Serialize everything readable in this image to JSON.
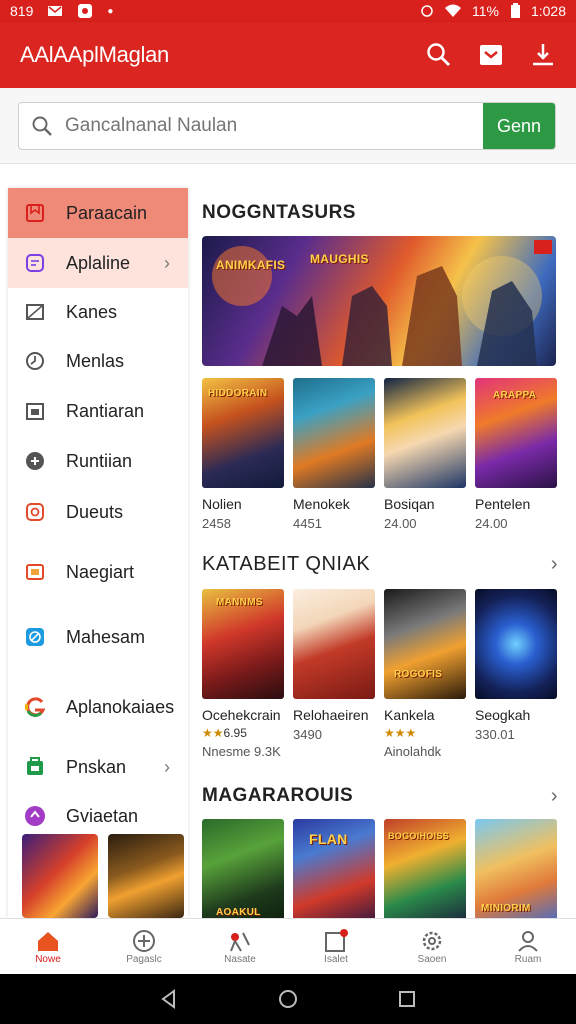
{
  "status": {
    "left_text": "819",
    "battery": "11%",
    "time": "1:028"
  },
  "app": {
    "title": "AAlAAplMaglan"
  },
  "search": {
    "placeholder": "Gancalnanal Naulan",
    "button_label": "Genn"
  },
  "sidebar": {
    "items": [
      {
        "label": "Paraacain",
        "icon": "bookmark-icon",
        "color": "#d8201c"
      },
      {
        "label": "Aplaline",
        "icon": "chat-icon",
        "color": "#7b3fe4"
      },
      {
        "label": "Kanes",
        "icon": "image-icon",
        "color": "#555555"
      },
      {
        "label": "Menlas",
        "icon": "clock-icon",
        "color": "#555555"
      },
      {
        "label": "Rantiaran",
        "icon": "calendar-icon",
        "color": "#555555"
      },
      {
        "label": "Runtiian",
        "icon": "gamepad-icon",
        "color": "#555555"
      },
      {
        "label": "Dueuts",
        "icon": "alarm-icon",
        "color": "#e24a2b"
      },
      {
        "label": "Naegiart",
        "icon": "wallet-icon",
        "color": "#e24a2b"
      },
      {
        "label": "Mahesam",
        "icon": "compass-icon",
        "color": "#1e9be0"
      },
      {
        "label": "Aplanokaiaes",
        "icon": "google-icon",
        "color": "#e24a2b"
      },
      {
        "label": "Pnskan",
        "icon": "bag-icon",
        "color": "#1f9a4a"
      },
      {
        "label": "Gviaetan",
        "icon": "puzzle-icon",
        "color": "#a23cc6"
      }
    ]
  },
  "sections": [
    {
      "title": "NOGGNTASURS",
      "banner_texts": [
        "ANIMKAFIS",
        "MAUGHIS"
      ],
      "cards": [
        {
          "name": "Nolien",
          "sub": "2458",
          "art_text": "HIDDORAIN"
        },
        {
          "name": "Menokek",
          "sub": "4451",
          "art_text": ""
        },
        {
          "name": "Bosiqan",
          "sub": "24.00",
          "art_text": ""
        },
        {
          "name": "Pentelen",
          "sub": "24.00",
          "art_text": "ARAPPA"
        }
      ]
    },
    {
      "title": "KATABEIT QNIAK",
      "cards": [
        {
          "name": "Ocehekcrain",
          "stars": "★★",
          "rating": "6.95",
          "sub": "Nnesme 9.3K",
          "art_text": "MANNMS"
        },
        {
          "name": "Relohaeiren",
          "sub": "3490",
          "art_text": ""
        },
        {
          "name": "Kankela",
          "stars": "★★★",
          "rating": "",
          "sub": "Ainolahdk",
          "art_text": "ROGOFIS"
        },
        {
          "name": "Seogkah",
          "sub": "330.01",
          "art_text": ""
        }
      ]
    },
    {
      "title": "MAGARAROUIS",
      "cards": [
        {
          "name": "",
          "sub": "",
          "art_text": "AOAKUL"
        },
        {
          "name": "",
          "sub": "",
          "art_text": "FLAN"
        },
        {
          "name": "",
          "sub": "",
          "art_text": "BOGOIHOISS"
        },
        {
          "name": "",
          "sub": "",
          "art_text": "MINIORIM"
        }
      ]
    }
  ],
  "nav": [
    {
      "label": "Nowe",
      "icon": "home-icon"
    },
    {
      "label": "Pagaslc",
      "icon": "target-icon"
    },
    {
      "label": "Nasate",
      "icon": "ribbon-icon"
    },
    {
      "label": "Isalet",
      "icon": "inbox-icon"
    },
    {
      "label": "Saoen",
      "icon": "gear-icon"
    },
    {
      "label": "Ruam",
      "icon": "profile-icon"
    }
  ],
  "colors": {
    "accent": "#da2520",
    "search_button": "#2e9944"
  }
}
